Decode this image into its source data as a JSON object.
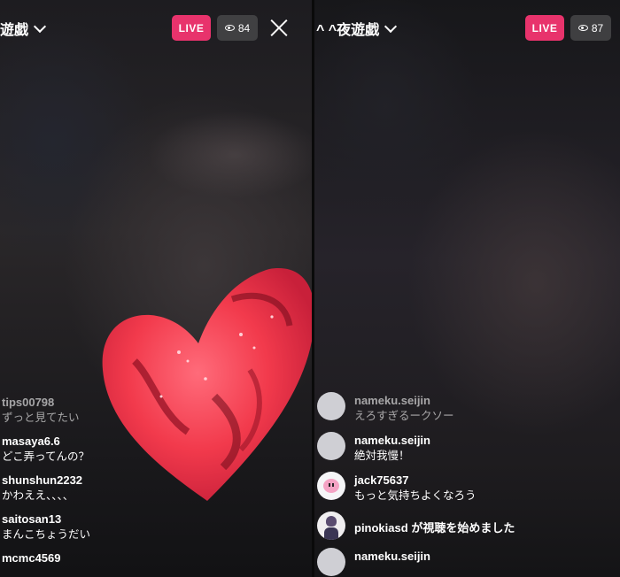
{
  "left_stream": {
    "title": "遊戯",
    "live_label": "LIVE",
    "viewer_count": "84",
    "comments": [
      {
        "user": "tips00798",
        "text": "ずっと見てたい"
      },
      {
        "user": "masaya6.6",
        "text": "どこ弄ってんの？"
      },
      {
        "user": "shunshun2232",
        "text": "かわええ、、、、"
      },
      {
        "user": "saitosan13",
        "text": "まんこちょうだい"
      },
      {
        "user": "mcmc4569",
        "text": ""
      }
    ]
  },
  "right_stream": {
    "title": "^ ^夜遊戯",
    "live_label": "LIVE",
    "viewer_count": "87",
    "comments": [
      {
        "user": "nameku.seijin",
        "text": "えろすぎるークソー",
        "avatar": "default-avatar"
      },
      {
        "user": "nameku.seijin",
        "text": "絶対我慢！",
        "avatar": "default-avatar"
      },
      {
        "user": "jack75637",
        "text": "もっと気持ちよくなろう",
        "avatar": "pink-character-avatar"
      },
      {
        "user": "pinokiasd",
        "join_text": "が視聴を始めました",
        "avatar": "person-avatar"
      },
      {
        "user": "nameku.seijin",
        "text": "",
        "avatar": "default-avatar"
      }
    ]
  },
  "icons": {
    "eye": "eye-icon",
    "close": "close-icon",
    "chevron": "chevron-down-icon",
    "sticker": "heart-sticker"
  },
  "colors": {
    "live_badge": "#e8336c",
    "viewer_badge": "#464648",
    "heart": "#f23a4c"
  }
}
